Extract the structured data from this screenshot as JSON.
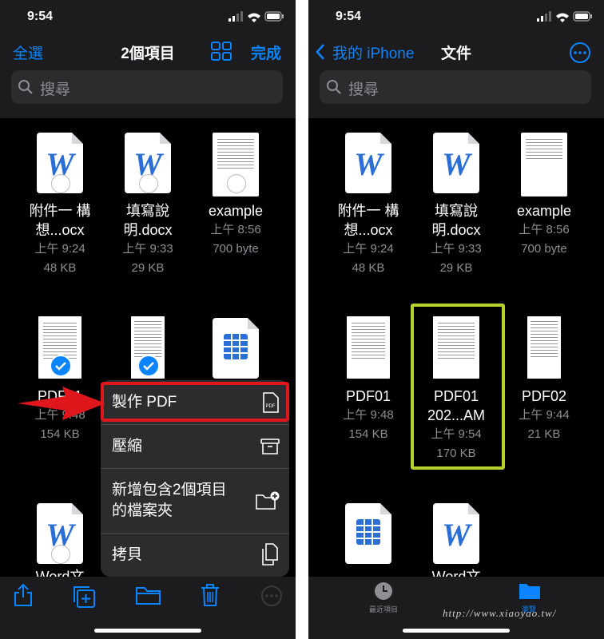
{
  "left": {
    "status_time": "9:54",
    "select_all": "全選",
    "title": "2個項目",
    "done": "完成",
    "search_placeholder": "搜尋",
    "files": [
      {
        "name1": "附件一 構",
        "name2": "想...ocx",
        "time": "上午 9:24",
        "size": "48 KB"
      },
      {
        "name1": "填寫說",
        "name2": "明.docx",
        "time": "上午 9:33",
        "size": "29 KB"
      },
      {
        "name1": "example",
        "name2": "",
        "time": "上午 8:56",
        "size": "700 byte"
      },
      {
        "name1": "PDF01",
        "time": "上午 9:48",
        "size": "154 KB"
      },
      {
        "name1": "Word文",
        "time": ""
      }
    ],
    "menu": [
      {
        "label": "製作 PDF"
      },
      {
        "label": "壓縮"
      },
      {
        "label1": "新增包含2個項目",
        "label2": "的檔案夾"
      },
      {
        "label": "拷貝"
      }
    ]
  },
  "right": {
    "status_time": "9:54",
    "back_label": "我的 iPhone",
    "title": "文件",
    "search_placeholder": "搜尋",
    "files": [
      {
        "name1": "附件一 構",
        "name2": "想...ocx",
        "time": "上午 9:24",
        "size": "48 KB"
      },
      {
        "name1": "填寫說",
        "name2": "明.docx",
        "time": "上午 9:33",
        "size": "29 KB"
      },
      {
        "name1": "example",
        "time": "上午 8:56",
        "size": "700 byte"
      },
      {
        "name1": "PDF01",
        "time": "上午 9:48",
        "size": "154 KB"
      },
      {
        "name1": "PDF01",
        "name2": "202...AM",
        "time": "上午 9:54",
        "size": "170 KB"
      },
      {
        "name1": "PDF02",
        "time": "上午 9:44",
        "size": "21 KB"
      },
      {
        "name1": "Word文"
      }
    ],
    "tabs": {
      "recent": "最近項目",
      "browse": "瀏覽"
    },
    "watermark": "http://www.xiaoyao.tw/"
  },
  "colors": {
    "accent": "#0a84ff",
    "highlight_red": "#e0161d",
    "highlight_green": "#b5d22c",
    "arrow_red": "#e0161d"
  }
}
